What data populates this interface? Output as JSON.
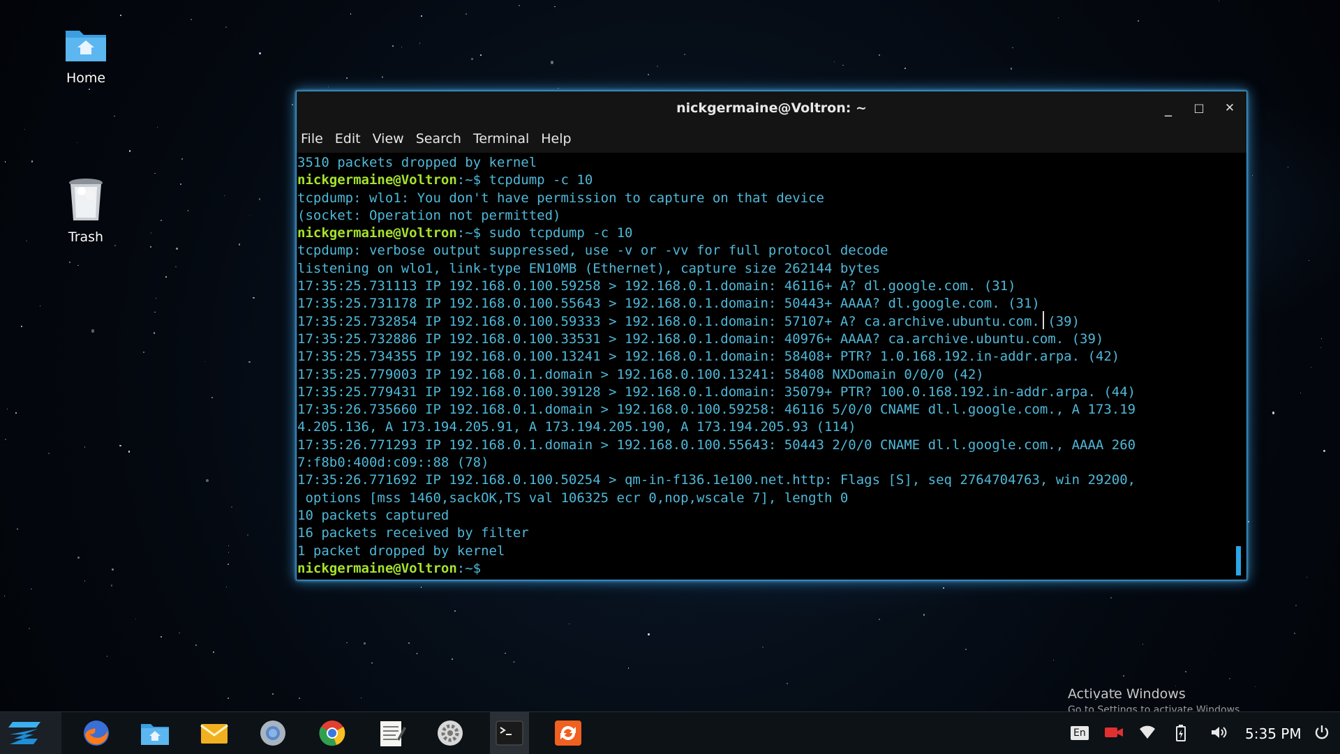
{
  "desktop": {
    "icons": [
      {
        "label": "Home"
      },
      {
        "label": "Trash"
      }
    ]
  },
  "window": {
    "title": "nickgermaine@Voltron: ~",
    "controls": {
      "minimize": "_",
      "maximize": "□",
      "close": "✕"
    },
    "menu": [
      "File",
      "Edit",
      "View",
      "Search",
      "Terminal",
      "Help"
    ],
    "terminal": {
      "prompt_user": "nickgermaine@Voltron",
      "prompt_sep": ":~$ ",
      "lines": [
        {
          "type": "out",
          "text": "3510 packets dropped by kernel"
        },
        {
          "type": "cmd",
          "text": "tcpdump -c 10"
        },
        {
          "type": "out",
          "text": "tcpdump: wlo1: You don't have permission to capture on that device"
        },
        {
          "type": "out",
          "text": "(socket: Operation not permitted)"
        },
        {
          "type": "cmd",
          "text": "sudo tcpdump -c 10"
        },
        {
          "type": "out",
          "text": "tcpdump: verbose output suppressed, use -v or -vv for full protocol decode"
        },
        {
          "type": "out",
          "text": "listening on wlo1, link-type EN10MB (Ethernet), capture size 262144 bytes"
        },
        {
          "type": "out",
          "text": "17:35:25.731113 IP 192.168.0.100.59258 > 192.168.0.1.domain: 46116+ A? dl.google.com. (31)"
        },
        {
          "type": "out",
          "text": "17:35:25.731178 IP 192.168.0.100.55643 > 192.168.0.1.domain: 50443+ AAAA? dl.google.com. (31)"
        },
        {
          "type": "out",
          "text": "17:35:25.732854 IP 192.168.0.100.59333 > 192.168.0.1.domain: 57107+ A? ca.archive.ubuntu.com. (39)"
        },
        {
          "type": "out",
          "text": "17:35:25.732886 IP 192.168.0.100.33531 > 192.168.0.1.domain: 40976+ AAAA? ca.archive.ubuntu.com. (39)"
        },
        {
          "type": "out",
          "text": "17:35:25.734355 IP 192.168.0.100.13241 > 192.168.0.1.domain: 58408+ PTR? 1.0.168.192.in-addr.arpa. (42)"
        },
        {
          "type": "out",
          "text": "17:35:25.779003 IP 192.168.0.1.domain > 192.168.0.100.13241: 58408 NXDomain 0/0/0 (42)"
        },
        {
          "type": "out",
          "text": "17:35:25.779431 IP 192.168.0.100.39128 > 192.168.0.1.domain: 35079+ PTR? 100.0.168.192.in-addr.arpa. (44)"
        },
        {
          "type": "out",
          "text": "17:35:26.735660 IP 192.168.0.1.domain > 192.168.0.100.59258: 46116 5/0/0 CNAME dl.l.google.com., A 173.19"
        },
        {
          "type": "out",
          "text": "4.205.136, A 173.194.205.91, A 173.194.205.190, A 173.194.205.93 (114)"
        },
        {
          "type": "out",
          "text": "17:35:26.771293 IP 192.168.0.1.domain > 192.168.0.100.55643: 50443 2/0/0 CNAME dl.l.google.com., AAAA 260"
        },
        {
          "type": "out",
          "text": "7:f8b0:400d:c09::88 (78)"
        },
        {
          "type": "out",
          "text": "17:35:26.771692 IP 192.168.0.100.50254 > qm-in-f136.1e100.net.http: Flags [S], seq 2764704763, win 29200,"
        },
        {
          "type": "out",
          "text": " options [mss 1460,sackOK,TS val 106325 ecr 0,nop,wscale 7], length 0"
        },
        {
          "type": "out",
          "text": "10 packets captured"
        },
        {
          "type": "out",
          "text": "16 packets received by filter"
        },
        {
          "type": "out",
          "text": "1 packet dropped by kernel"
        },
        {
          "type": "cmd",
          "text": ""
        }
      ]
    }
  },
  "watermark": {
    "line1": "Activate Windows",
    "line2": "Go to Settings to activate Windows."
  },
  "taskbar": {
    "apps": [
      "firefox-icon",
      "files-icon",
      "mail-icon",
      "browser-icon",
      "chrome-icon",
      "text-editor-icon",
      "settings-icon",
      "terminal-icon",
      "software-updater-icon"
    ],
    "tray": {
      "keyboard_layout": "En"
    },
    "clock": "5:35 PM"
  },
  "colors": {
    "terminal_text": "#4fb8d8",
    "prompt_user": "#a6e22e",
    "window_glow": "#3aa0d8"
  }
}
